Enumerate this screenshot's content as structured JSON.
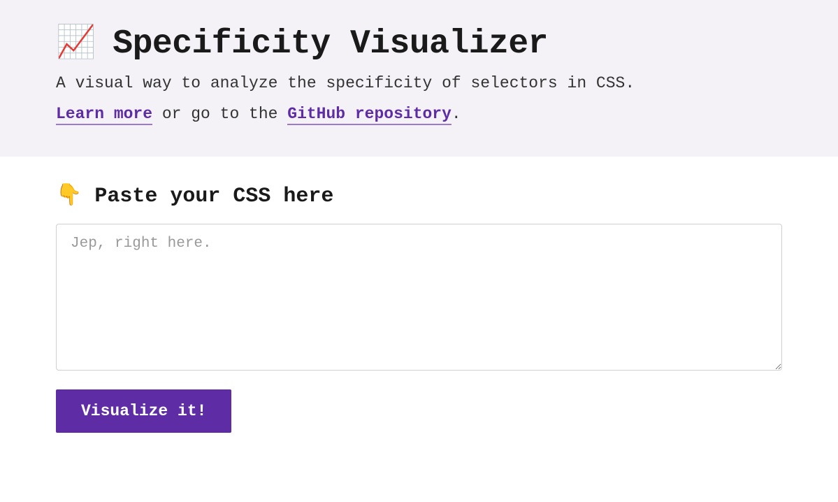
{
  "header": {
    "icon": "📈",
    "title": "Specificity Visualizer",
    "subtitle": "A visual way to analyze the specificity of selectors in CSS.",
    "learn_more_label": "Learn more",
    "links_middle": " or go to the ",
    "github_label": "GitHub repository",
    "links_end": "."
  },
  "main": {
    "section_icon": "👇",
    "section_heading": "Paste your CSS here",
    "textarea_placeholder": "Jep, right here.",
    "textarea_value": "",
    "button_label": "Visualize it!"
  }
}
